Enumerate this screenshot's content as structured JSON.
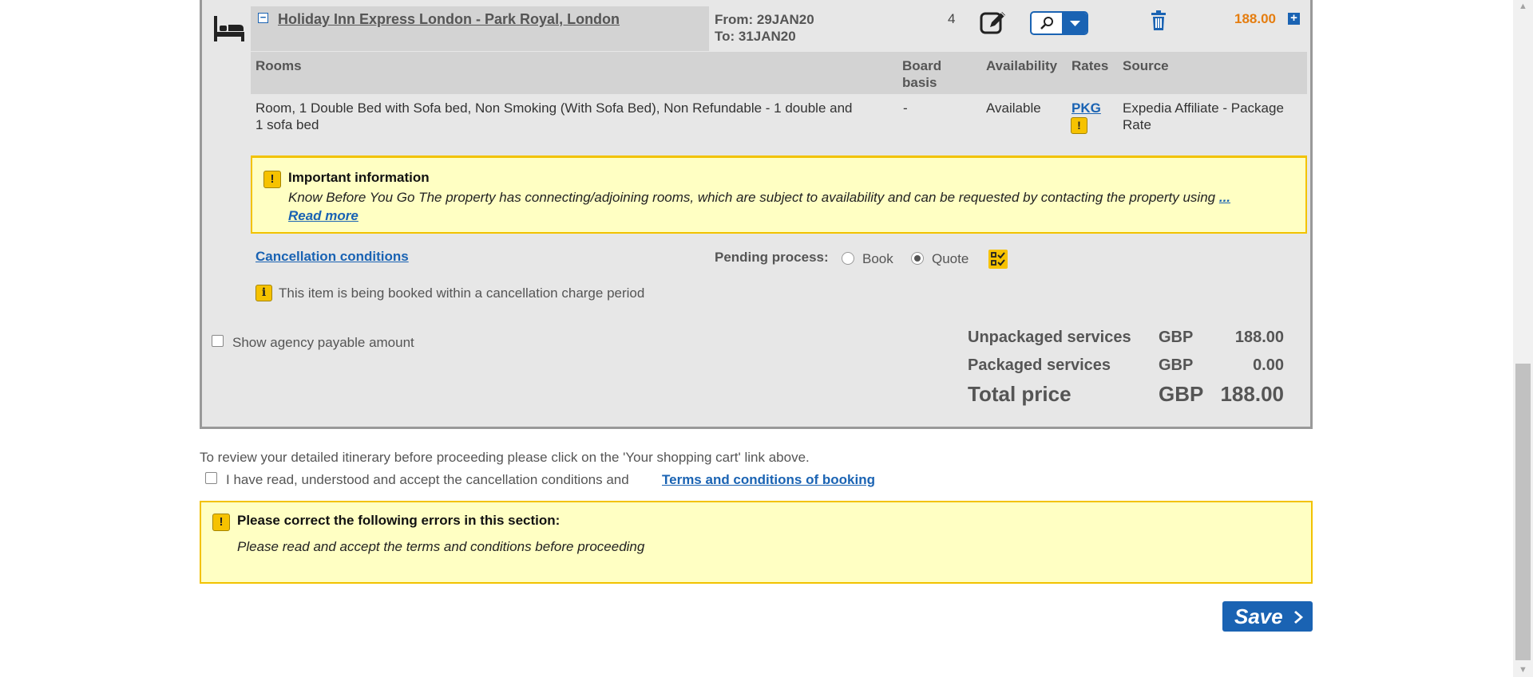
{
  "hotel": {
    "name": "Holiday Inn Express London - Park Royal, London",
    "collapse_symbol": "−",
    "from": "From: 29JAN20",
    "to": "To: 31JAN20",
    "quantity": "4",
    "price": "188.00",
    "expand_symbol": "+"
  },
  "rooms_table": {
    "headers": {
      "rooms": "Rooms",
      "board_basis_1": "Board",
      "board_basis_2": "basis",
      "availability": "Availability",
      "rates": "Rates",
      "source": "Source"
    },
    "row": {
      "room_line1": "Room, 1 Double Bed with Sofa bed, Non Smoking (With Sofa Bed), Non Refundable - 1 double and",
      "room_line2": "1 sofa bed",
      "board_basis": "-",
      "availability": "Available",
      "rate": "PKG",
      "source_line1": "Expedia Affiliate - Package",
      "source_line2": "Rate"
    }
  },
  "important": {
    "title": "Important information",
    "text": "Know Before You Go The property has connecting/adjoining rooms, which are subject to availability and can be requested by contacting the property using",
    "ellipsis": "...",
    "read_more": "Read more"
  },
  "cancellation_link": "Cancellation conditions",
  "pending": {
    "label": "Pending process:",
    "options": [
      "Book",
      "Quote"
    ],
    "selected": "Quote"
  },
  "cancellation_notice": "This item is being booked within a cancellation charge period",
  "show_agency_label": "Show agency payable amount",
  "summary": {
    "unpackaged": {
      "label": "Unpackaged services",
      "currency": "GBP",
      "value": "188.00"
    },
    "packaged": {
      "label": "Packaged services",
      "currency": "GBP",
      "value": "0.00"
    },
    "total": {
      "label": "Total price",
      "currency": "GBP",
      "value": "188.00"
    }
  },
  "review_text": "To review your detailed itinerary before proceeding please click on the 'Your shopping cart' link above.",
  "accept": {
    "label": "I have read, understood and accept the cancellation conditions and",
    "terms_link": "Terms and conditions of booking"
  },
  "errors": {
    "title": "Please correct the following errors in this section:",
    "message": "Please read and accept the terms and conditions before proceeding"
  },
  "save_label": "Save",
  "colors": {
    "brand_blue": "#1a63b3",
    "price_orange": "#e57d0f",
    "warning_yellow": "#f6c200",
    "notice_bg": "#ffffc3"
  }
}
